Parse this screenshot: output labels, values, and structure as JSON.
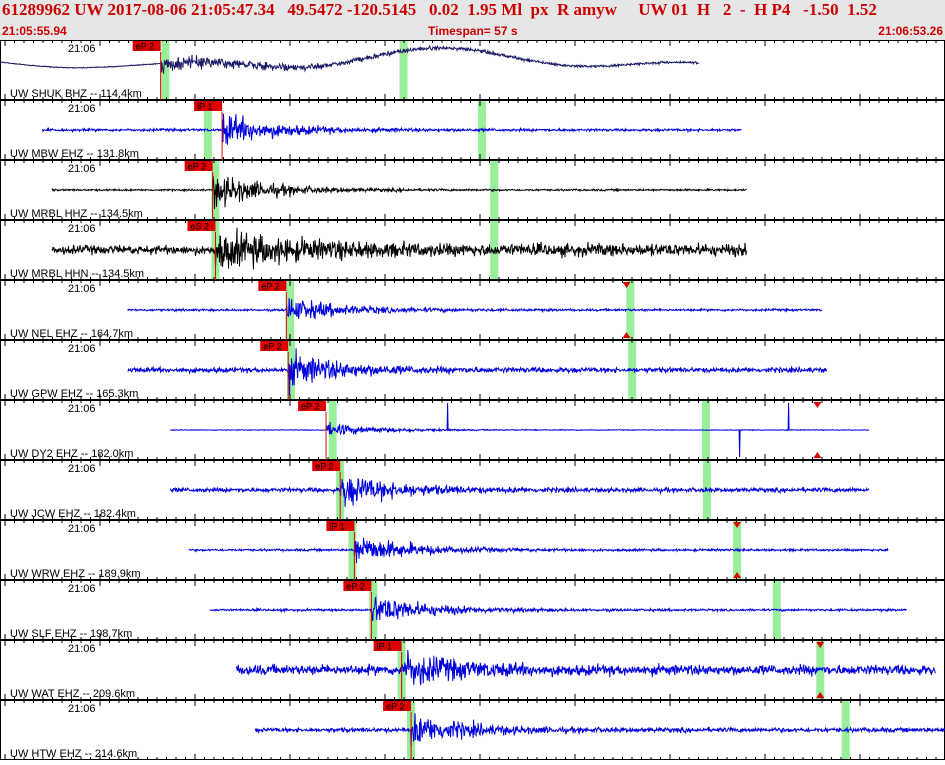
{
  "header": {
    "title": "61289962 UW 2017-08-06 21:05:47.34   49.5472 -120.5145   0.02  1.95 Ml  px  R amyw     UW 01  H   2  -  H P4   -1.50  1.52",
    "start_time": "21:05:55.94",
    "timespan": "Timespan=  57 s",
    "end_time": "21:06:53.26"
  },
  "colors": {
    "header_bg": "#e6e6e6",
    "header_text": "#cc0000",
    "pick_marker": "#dd0000",
    "pick_window": "#99ee99",
    "trace_blue": "#0000dd",
    "trace_navy": "#1a1a66",
    "trace_black": "#000000",
    "tick": "#000000"
  },
  "channels": [
    {
      "label": "UW SHUK BHZ -- 114.4km",
      "time": "21:06",
      "pick": "eP 2",
      "color": "#1a1a66",
      "type": "wave",
      "start": 0.0,
      "end": 0.74,
      "onset": 0.17,
      "amp": 0.35,
      "noise": 0.04,
      "green": [
        0.175,
        0.427
      ],
      "arrow": null
    },
    {
      "label": "UW MBW EHZ -- 131.8km",
      "time": "21:06",
      "pick": "iP 1",
      "color": "#0000dd",
      "type": "burst",
      "start": 0.045,
      "end": 0.785,
      "onset": 0.235,
      "amp": 0.9,
      "noise": 0.07,
      "green": [
        0.22,
        0.51
      ],
      "arrow": null
    },
    {
      "label": "UW MRBL HHZ -- 134.5km",
      "time": "21:06",
      "pick": "eP 2",
      "color": "#000000",
      "type": "burst",
      "start": 0.055,
      "end": 0.79,
      "onset": 0.225,
      "amp": 0.95,
      "noise": 0.05,
      "green": [
        0.228,
        0.523
      ],
      "arrow": null
    },
    {
      "label": "UW MRBL HHN -- 134.5km",
      "time": "21:06",
      "pick": "eS 2",
      "color": "#000000",
      "type": "burst2",
      "start": 0.055,
      "end": 0.79,
      "onset": 0.228,
      "amp": 0.9,
      "noise": 0.25,
      "green": [
        0.228,
        0.523
      ],
      "arrow": null
    },
    {
      "label": "UW NEL EHZ -- 164.7km",
      "time": "21:06",
      "pick": "eP 2",
      "color": "#0000dd",
      "type": "burst",
      "start": 0.135,
      "end": 0.87,
      "onset": 0.303,
      "amp": 0.7,
      "noise": 0.06,
      "green": [
        0.307,
        0.667
      ],
      "arrow": 0.663
    },
    {
      "label": "UW GPW EHZ -- 165.3km",
      "time": "21:06",
      "pick": "eP 2",
      "color": "#0000dd",
      "type": "burst",
      "start": 0.135,
      "end": 0.875,
      "onset": 0.305,
      "amp": 0.9,
      "noise": 0.14,
      "green": [
        0.308,
        0.669
      ],
      "arrow": null
    },
    {
      "label": "UW DY2 EHZ -- 182.0km",
      "time": "21:06",
      "pick": "eP 2",
      "color": "#0000dd",
      "type": "spikes",
      "start": 0.18,
      "end": 0.92,
      "onset": 0.345,
      "amp": 0.35,
      "noise": 0.02,
      "green": [
        0.352,
        0.747
      ],
      "arrow": 0.865
    },
    {
      "label": "UW JCW EHZ -- 182.4km",
      "time": "21:06",
      "pick": "eP 2",
      "color": "#0000dd",
      "type": "burst",
      "start": 0.18,
      "end": 0.92,
      "onset": 0.36,
      "amp": 0.9,
      "noise": 0.12,
      "green": [
        0.36,
        0.748
      ],
      "arrow": null
    },
    {
      "label": "UW WRW EHZ -- 189.9km",
      "time": "21:06",
      "pick": "iP 1",
      "color": "#0000dd",
      "type": "burst",
      "start": 0.2,
      "end": 0.94,
      "onset": 0.375,
      "amp": 0.85,
      "noise": 0.06,
      "green": [
        0.373,
        0.78
      ],
      "arrow": 0.78
    },
    {
      "label": "UW SLF EHZ -- 198.7km",
      "time": "21:06",
      "pick": "eP 2",
      "color": "#0000dd",
      "type": "burst",
      "start": 0.222,
      "end": 0.96,
      "onset": 0.393,
      "amp": 0.85,
      "noise": 0.06,
      "green": [
        0.395,
        0.822
      ],
      "arrow": null
    },
    {
      "label": "UW WAT EHZ -- 209.6km",
      "time": "21:06",
      "pick": "iP 1",
      "color": "#0000dd",
      "type": "burst",
      "start": 0.25,
      "end": 0.99,
      "onset": 0.425,
      "amp": 0.85,
      "noise": 0.28,
      "green": [
        0.425,
        0.868
      ],
      "arrow": 0.868
    },
    {
      "label": "UW HTW EHZ -- 214.6km",
      "time": "21:06",
      "pick": "eP 2",
      "color": "#0000dd",
      "type": "burst",
      "start": 0.27,
      "end": 1.0,
      "onset": 0.435,
      "amp": 0.85,
      "noise": 0.12,
      "green": [
        0.435,
        0.895
      ],
      "arrow": null
    }
  ]
}
